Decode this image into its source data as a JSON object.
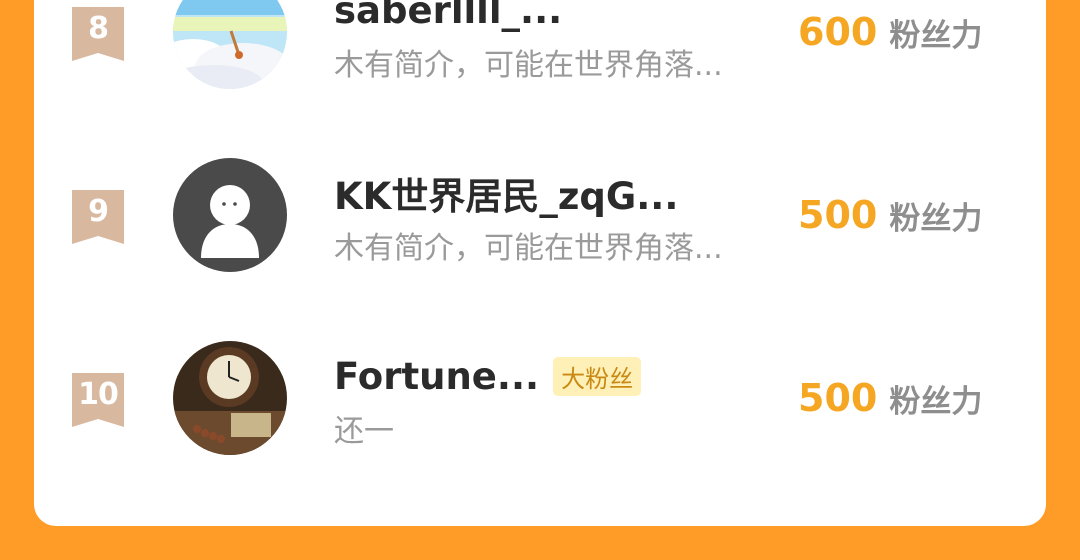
{
  "colors": {
    "background": "#FF9C27",
    "card": "#FFFFFF",
    "rank_ribbon": "#D9B8A0",
    "score": "#F5A623",
    "badge_bg": "#FFF0B8",
    "badge_text": "#C98A14"
  },
  "ranking": {
    "entries": [
      {
        "rank": "8",
        "name": "saberllll_...",
        "bio": "木有简介，可能在世界角落...",
        "score": "600",
        "score_unit": "粉丝力",
        "avatar_icon": "anime-sky-avatar"
      },
      {
        "rank": "9",
        "name": "KK世界居民_zqG...",
        "bio": "木有简介，可能在世界角落...",
        "score": "500",
        "score_unit": "粉丝力",
        "avatar_icon": "default-person-avatar"
      },
      {
        "rank": "10",
        "name": "Fortune...",
        "badge": "大粉丝",
        "bio": "还一",
        "score": "500",
        "score_unit": "粉丝力",
        "avatar_icon": "clock-photo-avatar"
      }
    ]
  }
}
